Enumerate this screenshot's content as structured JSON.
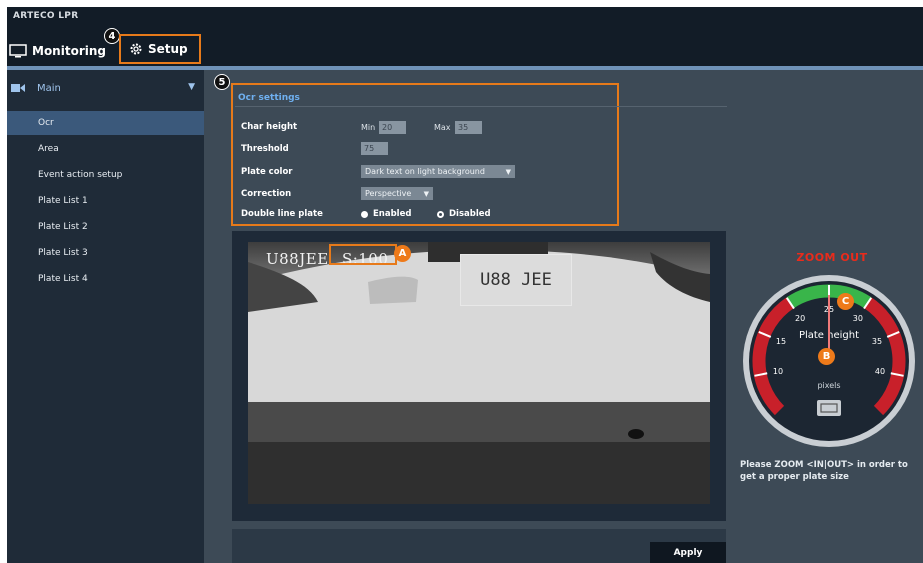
{
  "app": {
    "title": "ARTECO LPR"
  },
  "tabs": {
    "monitoring": {
      "label": "Monitoring",
      "icon": "monitor-icon"
    },
    "setup": {
      "label": "Setup",
      "icon": "gear-icon"
    }
  },
  "callouts": {
    "c4": "4",
    "c5": "5",
    "a": "A",
    "b": "B",
    "c": "C"
  },
  "sidebar": {
    "main_label": "Main",
    "main_icon": "camera-icon",
    "items": [
      {
        "label": "Ocr"
      },
      {
        "label": "Area"
      },
      {
        "label": "Event action setup"
      },
      {
        "label": "Plate List 1"
      },
      {
        "label": "Plate List 2"
      },
      {
        "label": "Plate List 3"
      },
      {
        "label": "Plate List 4"
      }
    ]
  },
  "ocr": {
    "title": "Ocr settings",
    "char_height_label": "Char height",
    "min_label": "Min",
    "min_value": "20",
    "max_label": "Max",
    "max_value": "35",
    "threshold_label": "Threshold",
    "threshold_value": "75",
    "plate_color_label": "Plate color",
    "plate_color_value": "Dark text on light background",
    "correction_label": "Correction",
    "correction_value": "Perspective",
    "double_line_label": "Double line plate",
    "enabled_label": "Enabled",
    "disabled_label": "Disabled"
  },
  "camera": {
    "plate_text": "U88JEE",
    "score_text": "S:100",
    "plate_on_car": "U88 JEE"
  },
  "gauge": {
    "title": "ZOOM OUT",
    "label": "Plate height",
    "unit": "pixels",
    "ticks": [
      "10",
      "15",
      "20",
      "25",
      "30",
      "35",
      "40"
    ],
    "needle_value": 25,
    "min": 5,
    "max": 45
  },
  "hint": "Please ZOOM <IN|OUT> in order to get a proper plate size",
  "apply_label": "Apply",
  "colors": {
    "accent": "#e77a1a",
    "gauge_green": "#39b54a",
    "gauge_red": "#c8202a"
  }
}
